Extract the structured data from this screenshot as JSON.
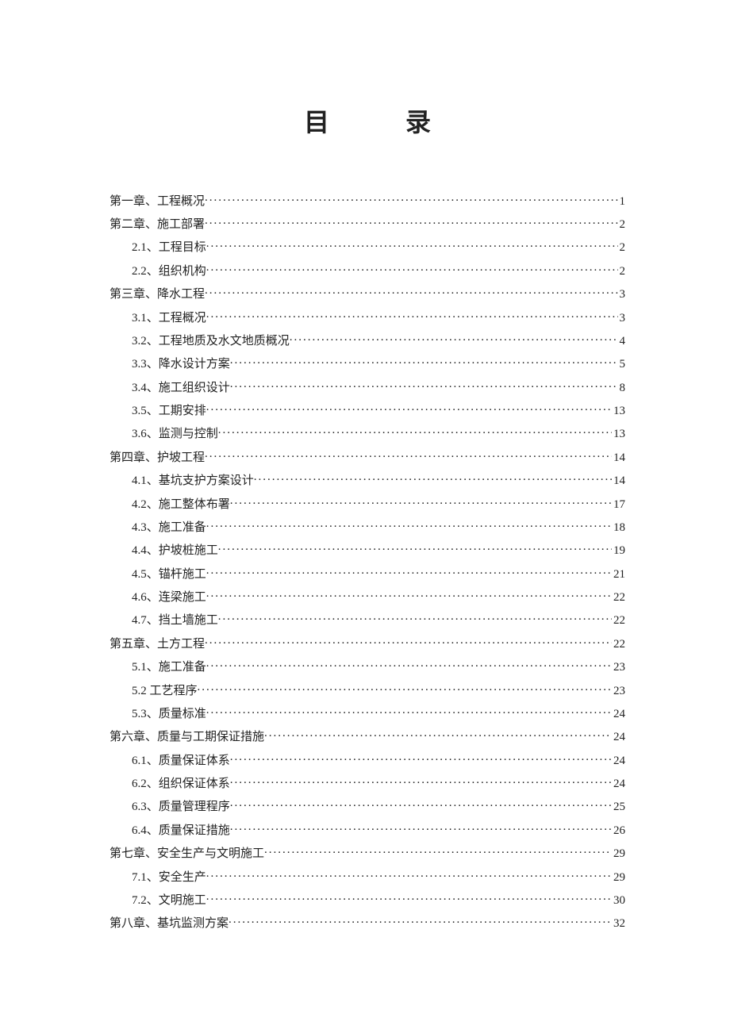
{
  "title_left": "目",
  "title_right": "录",
  "toc": [
    {
      "level": 1,
      "label": "第一章、工程概况",
      "page": "1"
    },
    {
      "level": 1,
      "label": "第二章、施工部署",
      "page": "2"
    },
    {
      "level": 2,
      "label": "2.1、工程目标",
      "page": "2"
    },
    {
      "level": 2,
      "label": "2.2、组织机构",
      "page": "2"
    },
    {
      "level": 1,
      "label": "第三章、降水工程",
      "page": "3"
    },
    {
      "level": 2,
      "label": "3.1、工程概况",
      "page": "3"
    },
    {
      "level": 2,
      "label": "3.2、工程地质及水文地质概况",
      "page": "4"
    },
    {
      "level": 2,
      "label": "3.3、降水设计方案",
      "page": "5"
    },
    {
      "level": 2,
      "label": "3.4、施工组织设计",
      "page": "8"
    },
    {
      "level": 2,
      "label": "3.5、工期安排",
      "page": "13"
    },
    {
      "level": 2,
      "label": "3.6、监测与控制",
      "page": "13"
    },
    {
      "level": 1,
      "label": "第四章、护坡工程",
      "page": "14"
    },
    {
      "level": 2,
      "label": "4.1、基坑支护方案设计",
      "page": "14"
    },
    {
      "level": 2,
      "label": "4.2、施工整体布署",
      "page": "17"
    },
    {
      "level": 2,
      "label": "4.3、施工准备",
      "page": "18"
    },
    {
      "level": 2,
      "label": "4.4、护坡桩施工",
      "page": "19"
    },
    {
      "level": 2,
      "label": "4.5、锚杆施工",
      "page": "21"
    },
    {
      "level": 2,
      "label": "4.6、连梁施工",
      "page": "22"
    },
    {
      "level": 2,
      "label": "4.7、挡土墙施工",
      "page": "22"
    },
    {
      "level": 1,
      "label": "第五章、土方工程",
      "page": "22"
    },
    {
      "level": 2,
      "label": "5.1、施工准备",
      "page": "23"
    },
    {
      "level": 2,
      "label": "5.2 工艺程序",
      "page": "23"
    },
    {
      "level": 2,
      "label": "5.3、质量标准",
      "page": "24"
    },
    {
      "level": 1,
      "label": "第六章、质量与工期保证措施",
      "page": "24"
    },
    {
      "level": 2,
      "label": "6.1、质量保证体系",
      "page": "24"
    },
    {
      "level": 2,
      "label": "6.2、组织保证体系",
      "page": "24"
    },
    {
      "level": 2,
      "label": "6.3、质量管理程序",
      "page": "25"
    },
    {
      "level": 2,
      "label": "6.4、质量保证措施",
      "page": "26"
    },
    {
      "level": 1,
      "label": "第七章、安全生产与文明施工",
      "page": "29"
    },
    {
      "level": 2,
      "label": "7.1、安全生产",
      "page": "29"
    },
    {
      "level": 2,
      "label": "7.2、文明施工",
      "page": "30"
    },
    {
      "level": 1,
      "label": "第八章、基坑监测方案",
      "page": "32"
    }
  ]
}
